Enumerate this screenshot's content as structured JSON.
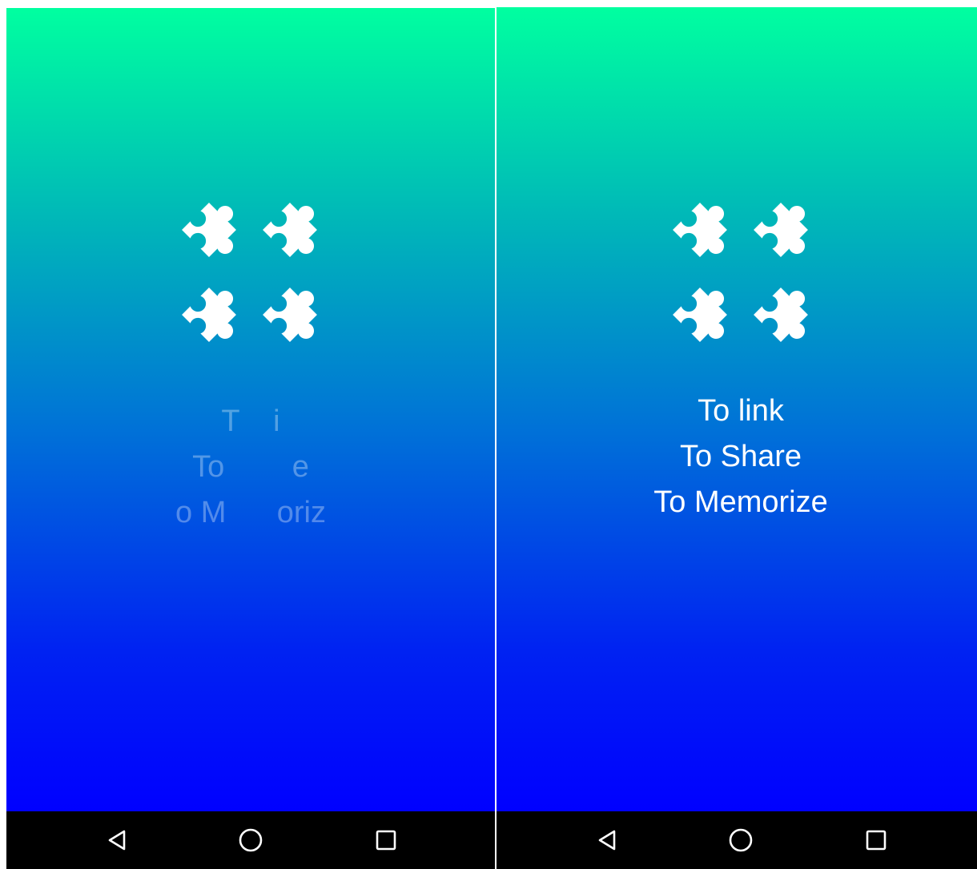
{
  "screens": [
    {
      "state": "animating",
      "tagline_lines": [
        "T    i",
        "To        e",
        "o M      oriz"
      ]
    },
    {
      "state": "final",
      "tagline_lines": [
        "To link",
        "To Share",
        "To Memorize"
      ]
    }
  ],
  "icons": {
    "logo": "puzzle-pieces-icon",
    "nav": [
      "back-triangle-icon",
      "home-circle-icon",
      "recents-square-icon"
    ]
  },
  "colors": {
    "gradient_top": "#00FFA0",
    "gradient_mid": "#0070D8",
    "gradient_bottom": "#0000FF",
    "navbar": "#000000",
    "text": "#FFFFFF"
  }
}
